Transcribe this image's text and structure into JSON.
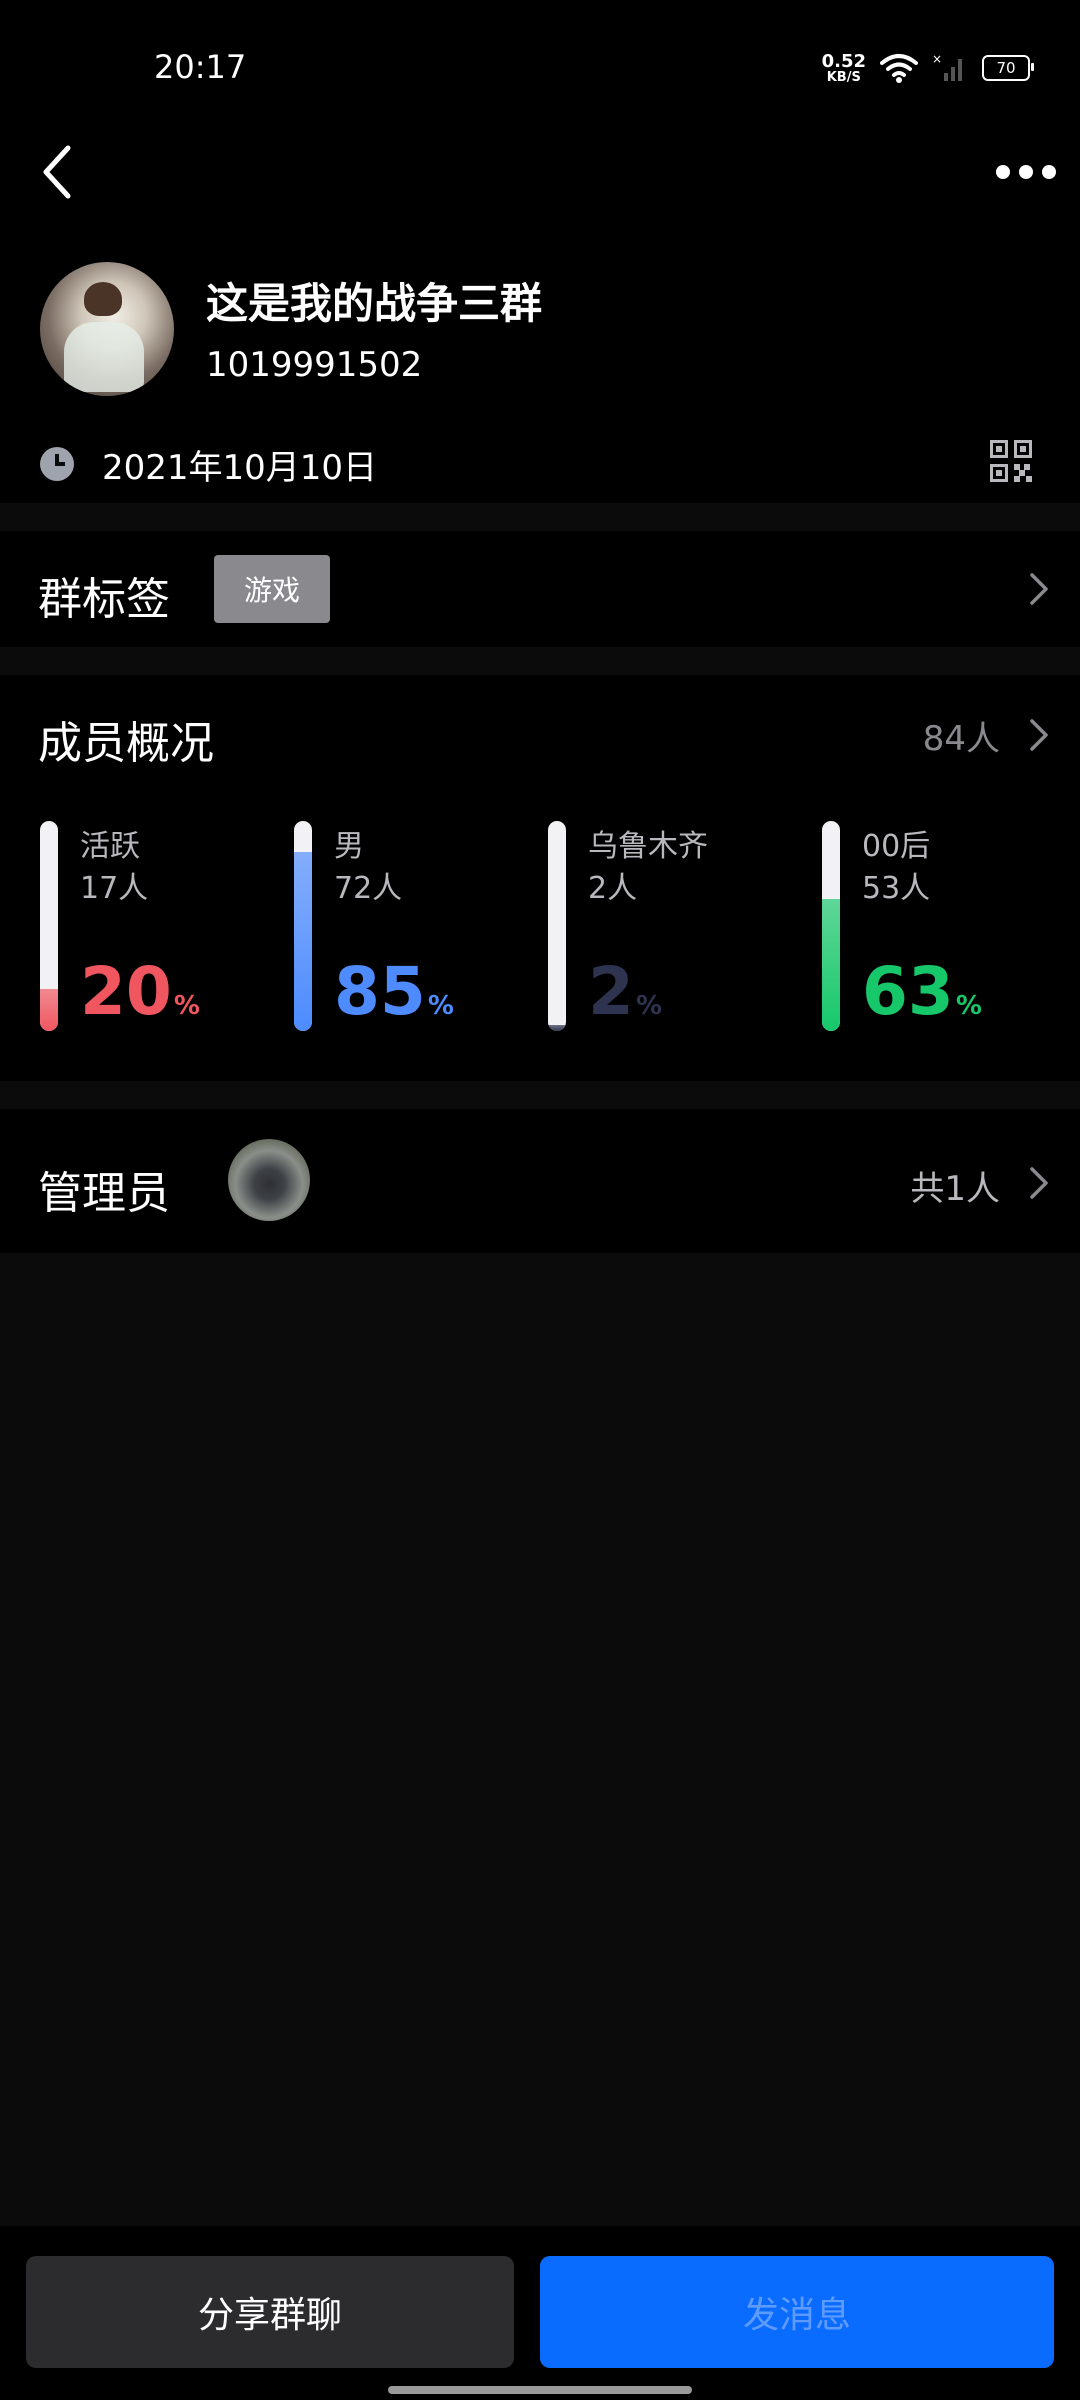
{
  "status_bar": {
    "time": "20:17",
    "net_speed_value": "0.52",
    "net_speed_unit": "KB/S",
    "battery": "70"
  },
  "header": {
    "back_icon": "chevron-left-icon",
    "more_icon": "more-dots-icon"
  },
  "group": {
    "name": "这是我的战争三群",
    "id": "1019991502",
    "created_date": "2021年10月10日"
  },
  "tags": {
    "title": "群标签",
    "items": [
      "游戏"
    ]
  },
  "members": {
    "title": "成员概况",
    "count": "84人",
    "stats": [
      {
        "label": "活跃",
        "count": "17人",
        "percent": "20",
        "pct_sign": "%",
        "value": 20,
        "color": "#f0565f"
      },
      {
        "label": "男",
        "count": "72人",
        "percent": "85",
        "pct_sign": "%",
        "value": 85,
        "color": "#4d8bff"
      },
      {
        "label": "乌鲁木齐",
        "count": "2人",
        "percent": "2",
        "pct_sign": "%",
        "value": 2,
        "color": "#2e3350"
      },
      {
        "label": "00后",
        "count": "53人",
        "percent": "63",
        "pct_sign": "%",
        "value": 63,
        "color": "#16c86a"
      }
    ]
  },
  "admins": {
    "title": "管理员",
    "count": "共1人"
  },
  "actions": {
    "share_label": "分享群聊",
    "send_label": "发消息"
  },
  "colors": {
    "background": "#0b0b0b",
    "card": "#000000",
    "accent_blue": "#0a6cff",
    "muted_text": "#8a8a8e"
  }
}
